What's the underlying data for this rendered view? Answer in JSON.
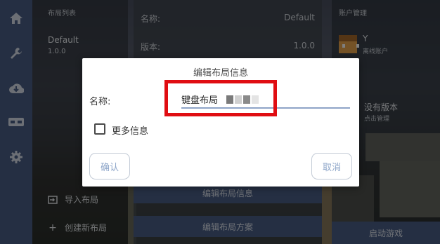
{
  "colors": {
    "accent": "#4b5f86",
    "highlight_box": "#e00d12",
    "dialog_button_text": "#8ea6c9",
    "input_underline": "#8ea3c7"
  },
  "nav": {
    "items": [
      {
        "icon": "home-icon"
      },
      {
        "icon": "wrench-icon"
      },
      {
        "icon": "cloud-download-icon"
      },
      {
        "icon": "controller-icon"
      },
      {
        "icon": "gear-icon"
      }
    ]
  },
  "layout_list": {
    "header": "布局列表",
    "items": [
      {
        "name": "Default",
        "version": "1.0.0"
      }
    ],
    "import_label": "导入布局",
    "create_label": "创建新布局"
  },
  "detail": {
    "name_key": "名称:",
    "name_value": "Default",
    "version_key": "版本:",
    "version_value": "1.0.0",
    "edit_info_button": "编辑布局信息",
    "edit_scheme_button": "编辑布局方案"
  },
  "account": {
    "header": "账户管理",
    "username_visible": "Y",
    "account_type": "离线账户",
    "version_title": "没有版本",
    "version_sub": "点击管理",
    "launch_button": "启动游戏"
  },
  "dialog": {
    "title": "编辑布局信息",
    "name_label": "名称:",
    "name_value": "键盘布局",
    "more_info_label": "更多信息",
    "more_info_checked": false,
    "confirm_button": "确认",
    "cancel_button": "取消"
  }
}
